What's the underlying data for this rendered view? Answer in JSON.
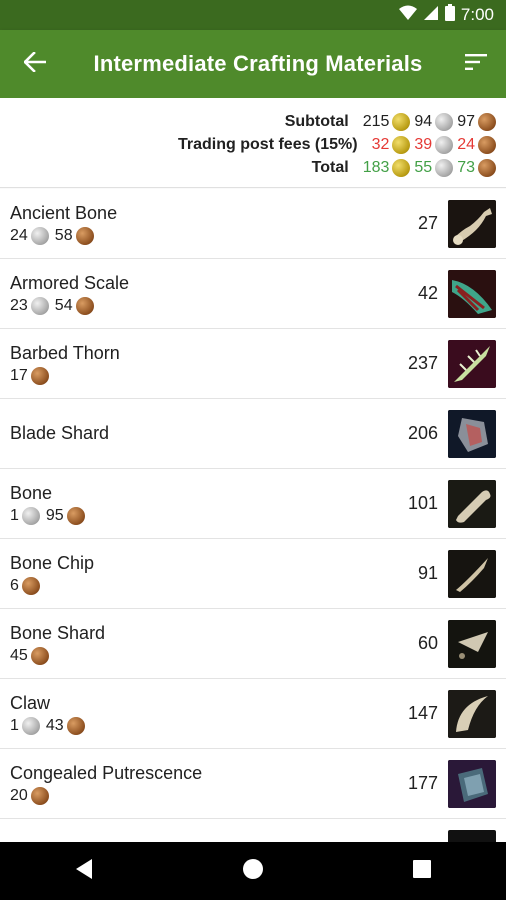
{
  "status": {
    "time": "7:00"
  },
  "appbar": {
    "title": "Intermediate Crafting Materials",
    "back_icon": "arrow-back-icon",
    "sort_icon": "sort-icon"
  },
  "summary": {
    "subtotal": {
      "label": "Subtotal",
      "gold": "215",
      "silver": "94",
      "copper": "97"
    },
    "fees": {
      "label": "Trading post fees (15%)",
      "gold": "32",
      "silver": "39",
      "copper": "24"
    },
    "total": {
      "label": "Total",
      "gold": "183",
      "silver": "55",
      "copper": "73"
    }
  },
  "items": [
    {
      "name": "Ancient Bone",
      "silver": "24",
      "copper": "58",
      "qty": "27",
      "icon": "ancient-bone-icon"
    },
    {
      "name": "Armored Scale",
      "silver": "23",
      "copper": "54",
      "qty": "42",
      "icon": "armored-scale-icon"
    },
    {
      "name": "Barbed Thorn",
      "copper": "17",
      "qty": "237",
      "icon": "barbed-thorn-icon"
    },
    {
      "name": "Blade Shard",
      "qty": "206",
      "icon": "blade-shard-icon"
    },
    {
      "name": "Bone",
      "silver": "1",
      "copper": "95",
      "qty": "101",
      "icon": "bone-icon"
    },
    {
      "name": "Bone Chip",
      "copper": "6",
      "qty": "91",
      "icon": "bone-chip-icon"
    },
    {
      "name": "Bone Shard",
      "copper": "45",
      "qty": "60",
      "icon": "bone-shard-icon"
    },
    {
      "name": "Claw",
      "silver": "1",
      "copper": "43",
      "qty": "147",
      "icon": "claw-icon"
    },
    {
      "name": "Congealed Putrescence",
      "copper": "20",
      "qty": "177",
      "icon": "congealed-putrescence-icon"
    }
  ],
  "colors": {
    "statusbar": "#3b6a1f",
    "appbar": "#4f8a2b",
    "fees": "#e53935",
    "total": "#43a047"
  }
}
